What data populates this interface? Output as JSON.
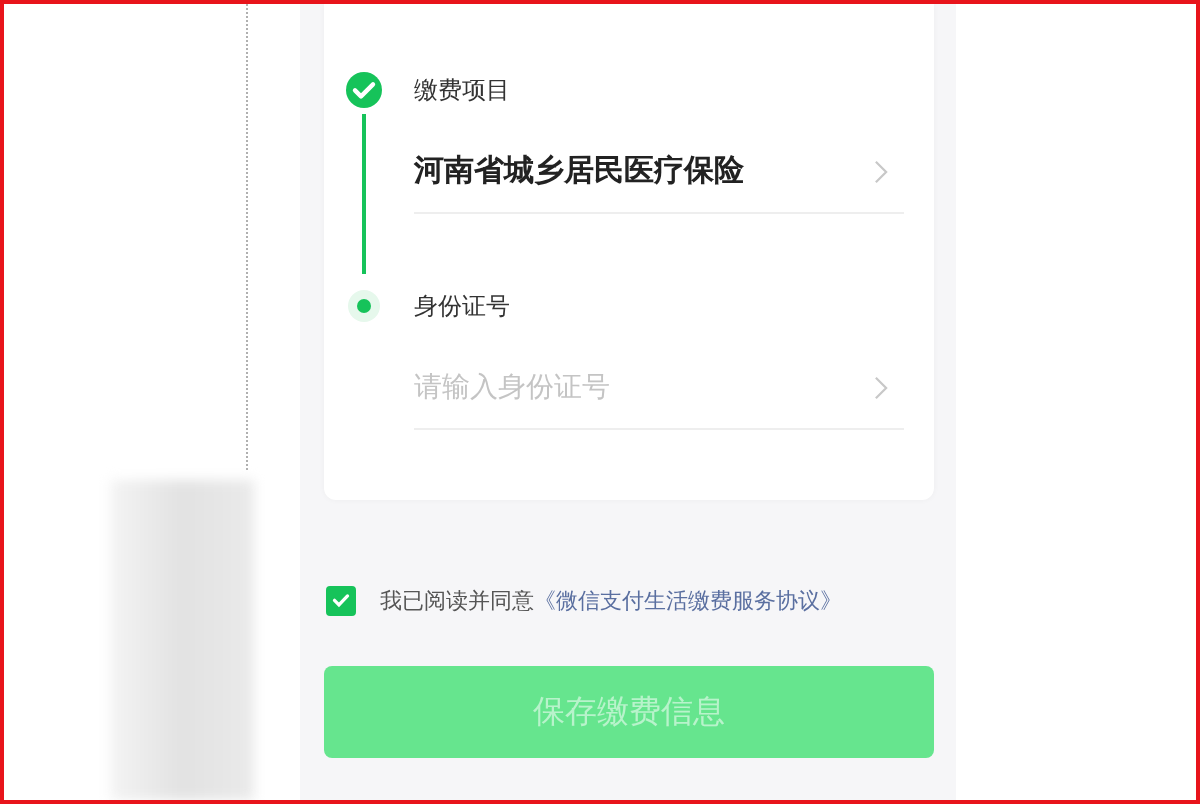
{
  "steps": [
    {
      "label": "缴费项目",
      "completed": true,
      "kind": "select",
      "value": "河南省城乡居民医疗保险"
    },
    {
      "label": "身份证号",
      "completed": false,
      "kind": "input",
      "placeholder": "请输入身份证号"
    }
  ],
  "agreement": {
    "checked": true,
    "text": "我已阅读并同意",
    "link": "《微信支付生活缴费服务协议》"
  },
  "save_button": {
    "label": "保存缴费信息",
    "disabled": true
  }
}
